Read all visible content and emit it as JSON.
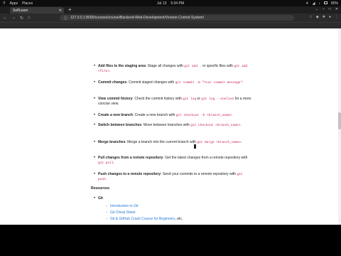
{
  "os": {
    "apps": "Apps",
    "places": "Places",
    "date": "Jul 13",
    "time": "5:34 PM",
    "battery": "80%"
  },
  "browser": {
    "tab_title": "SelfLearn",
    "new_tab": "+",
    "url": "127.0.0.1:8000/courses/course/Backend-Web-Development/Version-Control-System/"
  },
  "content": {
    "items": [
      {
        "title": "Add files to the staging area",
        "text_a": ": Stage all changes with ",
        "code_a": "git add .",
        "text_b": " or specific files with ",
        "code_b": "git add <file>",
        "text_c": "."
      },
      {
        "title": "Commit changes",
        "text_a": ": Commit staged changes with ",
        "code_a": "git commit -m \"Your commit message\"",
        "text_b": ".",
        "code_b": "",
        "text_c": ""
      },
      {
        "title": "View commit history",
        "text_a": ": Check the commit history with ",
        "code_a": "git log",
        "text_b": " or ",
        "code_b": "git log --oneline",
        "text_c": " for a more concise view."
      },
      {
        "title": "Create a new branch",
        "text_a": ": Create a new branch with ",
        "code_a": "git checkout -b <branch_name>",
        "text_b": ".",
        "code_b": "",
        "text_c": ""
      },
      {
        "title": "Switch between branches",
        "text_a": ": Move between branches with ",
        "code_a": "git checkout <branch_name>",
        "text_b": ".",
        "code_b": "",
        "text_c": ""
      },
      {
        "title": "Merge branches",
        "text_a": ": Merge a branch into the current branch with ",
        "code_a": "git merge <branch_name>",
        "text_b": ".",
        "code_b": "",
        "text_c": ""
      },
      {
        "title": "Pull changes from a remote repository",
        "text_a": ": Get the latest changes from a remote repository with ",
        "code_a": "git pull",
        "text_b": ".",
        "code_b": "",
        "text_c": ""
      },
      {
        "title": "Push changes to a remote repository",
        "text_a": ": Send your commits to a remote repository with ",
        "code_a": "git push",
        "text_b": ".",
        "code_b": "",
        "text_c": ""
      }
    ],
    "resources_label": "Resources:",
    "git_label": "Git",
    "links": [
      "Introduction to Git",
      "Git Cheat Sheet",
      "Git & GitHub Crash Course for Beginners"
    ],
    "links_suffix": ", etc."
  }
}
